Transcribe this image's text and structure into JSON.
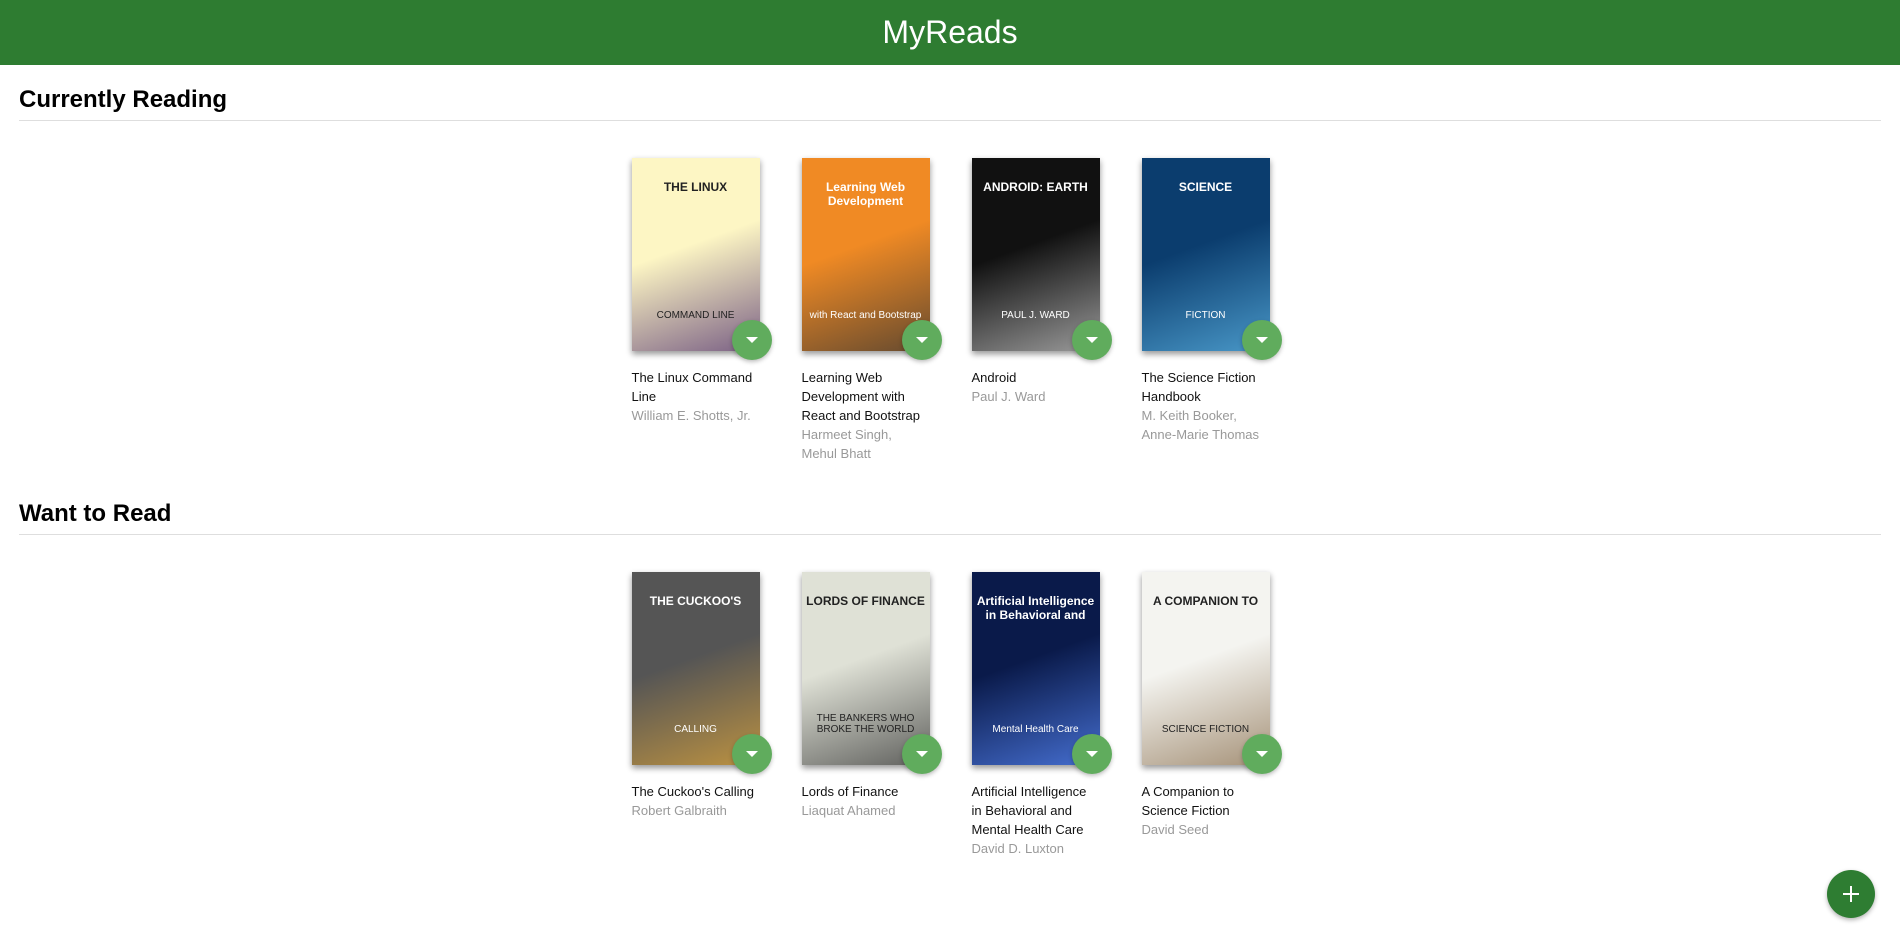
{
  "app": {
    "title": "MyReads"
  },
  "shelves": [
    {
      "title": "Currently Reading",
      "books": [
        {
          "title": "The Linux Command Line",
          "authors": "William E. Shotts, Jr.",
          "cover_text": [
            "THE LINUX",
            "COMMAND LINE"
          ],
          "colors": [
            "#fdf6c4",
            "#4b2a6e"
          ]
        },
        {
          "title": "Learning Web Development with React and Bootstrap",
          "authors": "Harmeet Singh, Mehul Bhatt",
          "cover_text": [
            "Learning Web Development",
            "with React and Bootstrap"
          ],
          "colors": [
            "#f08a24",
            "#333333"
          ]
        },
        {
          "title": "Android",
          "authors": "Paul J. Ward",
          "cover_text": [
            "ANDROID: EARTH",
            "PAUL J. WARD"
          ],
          "colors": [
            "#111111",
            "#cccccc"
          ]
        },
        {
          "title": "The Science Fiction Handbook",
          "authors": "M. Keith Booker, Anne-Marie Thomas",
          "cover_text": [
            "SCIENCE",
            "FICTION"
          ],
          "colors": [
            "#0b3d6e",
            "#5fb8e8"
          ]
        }
      ]
    },
    {
      "title": "Want to Read",
      "books": [
        {
          "title": "The Cuckoo's Calling",
          "authors": "Robert Galbraith",
          "cover_text": [
            "THE CUCKOO'S",
            "CALLING"
          ],
          "colors": [
            "#555555",
            "#e0a73a"
          ]
        },
        {
          "title": "Lords of Finance",
          "authors": "Liaquat Ahamed",
          "cover_text": [
            "LORDS OF FINANCE",
            "THE BANKERS WHO BROKE THE WORLD"
          ],
          "colors": [
            "#dfe1d6",
            "#333333"
          ]
        },
        {
          "title": "Artificial Intelligence in Behavioral and Mental Health Care",
          "authors": "David D. Luxton",
          "cover_text": [
            "Artificial Intelligence in Behavioral and",
            "Mental Health Care"
          ],
          "colors": [
            "#0a1a4a",
            "#5a8cff"
          ]
        },
        {
          "title": "A Companion to Science Fiction",
          "authors": "David Seed",
          "cover_text": [
            "A COMPANION TO",
            "SCIENCE FICTION"
          ],
          "colors": [
            "#f4f4f0",
            "#8a6f4e"
          ]
        }
      ]
    }
  ],
  "icons": {
    "shelf_changer": "arrow-drop-down-icon",
    "add": "add-icon"
  },
  "theme": {
    "header_bg": "#2e7c31",
    "button_bg": "#60ac5d",
    "fab_bg": "#2e7d32"
  }
}
